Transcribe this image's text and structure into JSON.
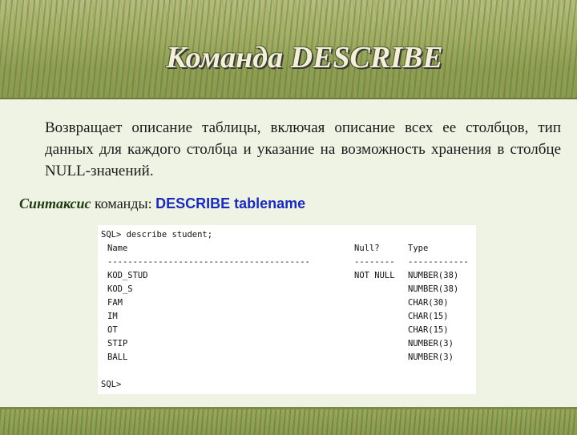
{
  "slide": {
    "title": "Команда DESCRIBE",
    "description": "Возвращает описание таблицы, включая описание всех ее столбцов, тип данных для каждого столбца и указание на возможность хранения в столбце NULL-значений.",
    "syntax_label": "Синтаксис",
    "syntax_text": "команды:",
    "syntax_command": "DESCRIBE tablename"
  },
  "console": {
    "prompt_command": "SQL> describe student;",
    "headers": {
      "name": "Name",
      "null": "Null?",
      "type": "Type"
    },
    "separators": {
      "name": "----------------------------------------",
      "null": "--------",
      "type": "------------"
    },
    "rows": [
      {
        "name": "KOD_STUD",
        "null": "NOT NULL",
        "type": "NUMBER(38)"
      },
      {
        "name": "KOD_S",
        "null": "",
        "type": "NUMBER(38)"
      },
      {
        "name": "FAM",
        "null": "",
        "type": "CHAR(30)"
      },
      {
        "name": "IM",
        "null": "",
        "type": "CHAR(15)"
      },
      {
        "name": "OT",
        "null": "",
        "type": "CHAR(15)"
      },
      {
        "name": "STIP",
        "null": "",
        "type": "NUMBER(3)"
      },
      {
        "name": "BALL",
        "null": "",
        "type": "NUMBER(3)"
      }
    ],
    "final_prompt": "SQL>"
  },
  "colors": {
    "command_blue": "#1a2bb8",
    "title_text": "#f4f0d8",
    "syntax_label_green": "#1d3a10"
  }
}
